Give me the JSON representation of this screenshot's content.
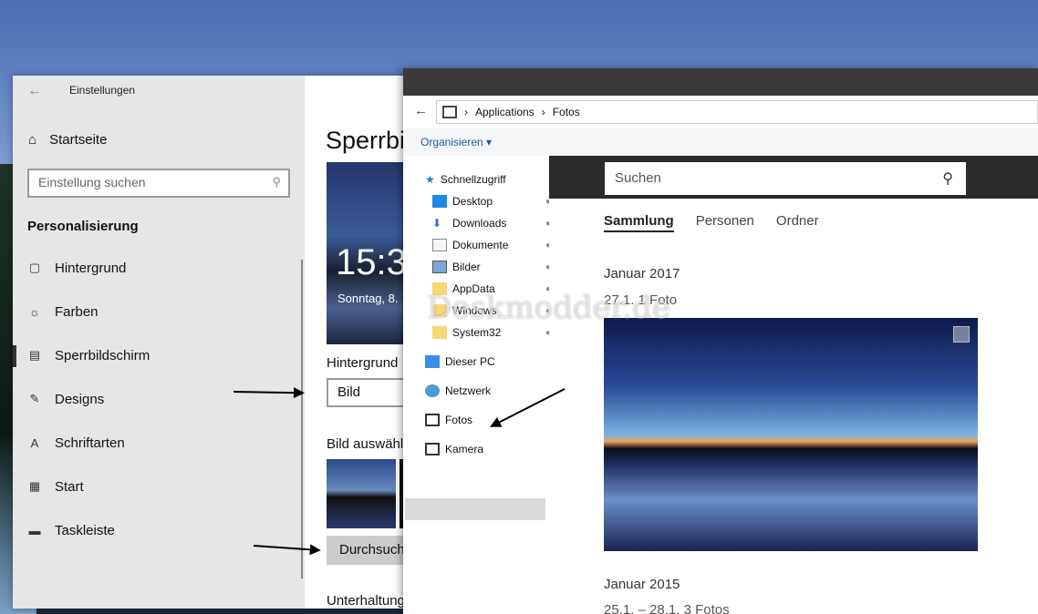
{
  "settings": {
    "title": "Einstellungen",
    "home": "Startseite",
    "search_placeholder": "Einstellung suchen",
    "section": "Personalisierung",
    "items": [
      {
        "label": "Hintergrund",
        "icon": "image-icon"
      },
      {
        "label": "Farben",
        "icon": "palette-icon"
      },
      {
        "label": "Sperrbildschirm",
        "icon": "lockscreen-icon"
      },
      {
        "label": "Designs",
        "icon": "designs-icon"
      },
      {
        "label": "Schriftarten",
        "icon": "fonts-icon"
      },
      {
        "label": "Start",
        "icon": "start-icon"
      },
      {
        "label": "Taskleiste",
        "icon": "taskbar-icon"
      }
    ],
    "main": {
      "heading": "Sperrbi",
      "time": "15:3",
      "date": "Sonntag, 8.",
      "background_label": "Hintergrund",
      "background_value": "Bild",
      "choose_label": "Bild auswähle",
      "browse": "Durchsuch",
      "entertainment": "Unterhaltung"
    }
  },
  "explorer": {
    "breadcrumb": [
      "Applications",
      "Fotos"
    ],
    "organize": "Organisieren",
    "nav": {
      "quick_access": "Schnellzugriff",
      "pinned": [
        "Desktop",
        "Downloads",
        "Dokumente",
        "Bilder",
        "AppData",
        "Windows",
        "System32"
      ],
      "this_pc": "Dieser PC",
      "network": "Netzwerk",
      "fotos": "Fotos",
      "camera": "Kamera"
    },
    "fotos": {
      "search_placeholder": "Suchen",
      "tabs": [
        "Sammlung",
        "Personen",
        "Ordner"
      ],
      "group1": "Januar 2017",
      "group1_sub": "27.1.    1 Foto",
      "group2": "Januar 2015",
      "group2_sub": "25.1. – 28.1.    3 Fotos"
    }
  },
  "watermark": "Deskmodder.de"
}
